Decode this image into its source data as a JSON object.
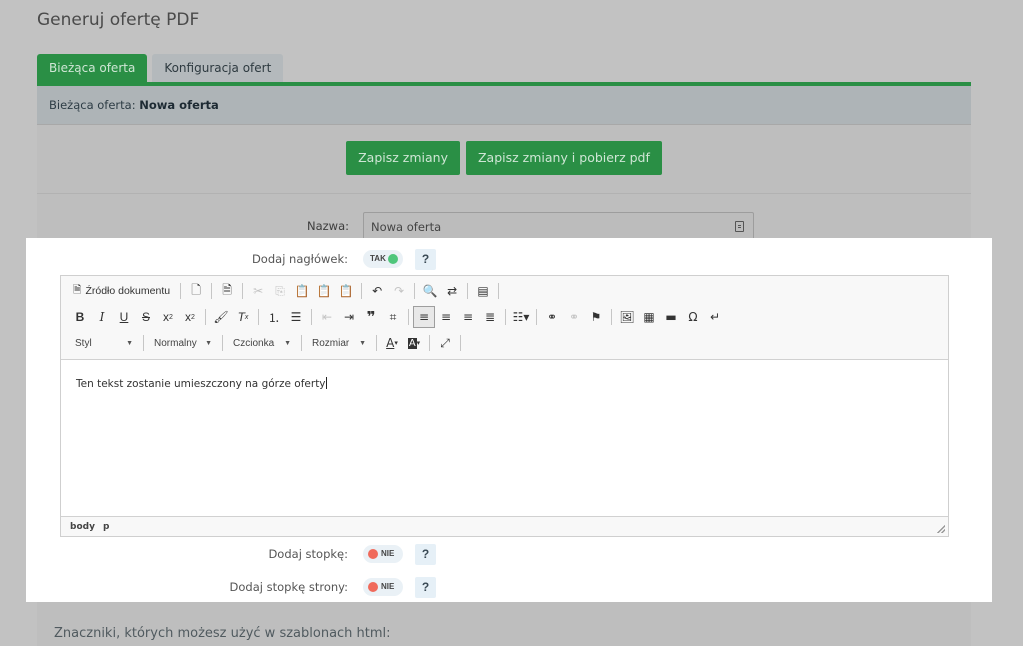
{
  "page": {
    "title": "Generuj ofertę PDF"
  },
  "tabs": [
    {
      "label": "Bieżąca oferta",
      "active": true
    },
    {
      "label": "Konfiguracja ofert",
      "active": false
    }
  ],
  "panel": {
    "header_prefix": "Bieżąca oferta:",
    "header_value": "Nowa oferta",
    "save_label": "Zapisz zmiany",
    "save_pdf_label": "Zapisz zmiany i pobierz pdf"
  },
  "form": {
    "name_label": "Nazwa:",
    "name_value": "Nowa oferta",
    "header_label": "Dodaj nagłówek:",
    "header_toggle": "TAK",
    "footer_label": "Dodaj stopkę:",
    "footer_toggle": "NIE",
    "page_footer_label": "Dodaj stopkę strony:",
    "page_footer_toggle": "NIE",
    "help": "?"
  },
  "editor": {
    "source_label": "Źródło dokumentu",
    "combos": {
      "style": "Styl",
      "format": "Normalny",
      "font": "Czcionka",
      "size": "Rozmiar"
    },
    "content": "Ten tekst zostanie umieszczony na górze oferty",
    "path": [
      "body",
      "p"
    ]
  },
  "markers_title": "Znaczniki, których możesz użyć w szablonach html:",
  "colors": {
    "accent": "#2a8f45",
    "toggle_on": "#4fc67b",
    "toggle_off": "#f06a5b"
  }
}
